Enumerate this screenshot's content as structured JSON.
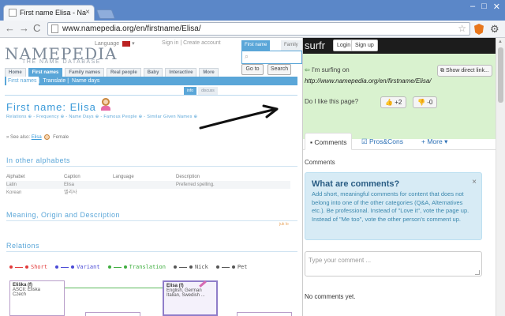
{
  "browser": {
    "tab_title": "First name Elisa - Namepedi",
    "tab_close": "×",
    "url": "www.namepedia.org/en/firstname/Elisa/",
    "back": "←",
    "forward": "→",
    "reload": "C",
    "star": "☆",
    "window_controls": [
      "–",
      "□",
      "✕"
    ]
  },
  "page": {
    "logo": "NAMEPEDIA",
    "logo_sub": "THE NAME DATABASE",
    "language_label": "Language",
    "toplinks": "Sign in  |  Create account",
    "search_tabs": [
      "First name",
      "Family nam"
    ],
    "goto": "Go to",
    "search": "Search",
    "nav": [
      "Home",
      "First names",
      "Family names",
      "Real people",
      "Baby",
      "Interactive",
      "More"
    ],
    "subnav": [
      "First names",
      "Translate",
      "Name days"
    ],
    "info_tabs": [
      "info",
      "discuss"
    ],
    "heading": "First name: Elisa",
    "crumbs": "Relations ⊕ - Frequency ⊕ - Name Days ⊕ - Famous People ⊕ - Similar Given Names ⊕",
    "see_also_label": "» See also:",
    "see_also_link": "Elisa",
    "see_also_gender": "Female",
    "section_alphabets": "In other alphabets",
    "alphabet_table": {
      "headers": [
        "Alphabet",
        "Caption",
        "Language",
        "Description"
      ],
      "rows": [
        [
          "Latin",
          "Elisa",
          "",
          "Preferred spelling."
        ],
        [
          "Korean",
          "엘리사",
          "",
          ""
        ]
      ]
    },
    "section_meaning": "Meaning, Origin and Description",
    "juk_link": "juk lo",
    "section_relations": "Relations",
    "legend": [
      {
        "label": "Short",
        "color": "#e23b3b"
      },
      {
        "label": "Variant",
        "color": "#4a4ad6"
      },
      {
        "label": "Translation",
        "color": "#3fae3f"
      },
      {
        "label": "Nick",
        "color": "#555555"
      },
      {
        "label": "Pet",
        "color": "#555555"
      }
    ],
    "relation_left": {
      "name": "Eliška (f)",
      "line1": "ASCII: Eliska",
      "line2": "Czech"
    },
    "relation_right": {
      "name": "Elisa (f)",
      "line1": "English, German",
      "line2": "Italian, Swedish ..."
    }
  },
  "surfr": {
    "brand": "surfr",
    "login": "Login",
    "signup": "Sign up",
    "surfing_on": "I'm surfing on",
    "url": "http://www.namepedia.org/en/firstname/Elisa/",
    "show_link": "Show direct link...",
    "like_question": "Do I like this page?",
    "vote_up": "+2",
    "vote_down": "-0",
    "tabs": [
      "Comments",
      "Pros&Cons",
      "More"
    ],
    "comments_label": "Comments",
    "info_title": "What are comments?",
    "info_text": "Add short, meaningful comments for content that does not belong into one of the other categories (Q&A, Alternatives etc.). Be professional. Instead of \"Love it\", vote the page up. Instead of \"Me too\", vote the other person's comment up.",
    "info_close": "×",
    "comment_placeholder": "Type your comment ...",
    "no_comments": "No comments yet."
  }
}
